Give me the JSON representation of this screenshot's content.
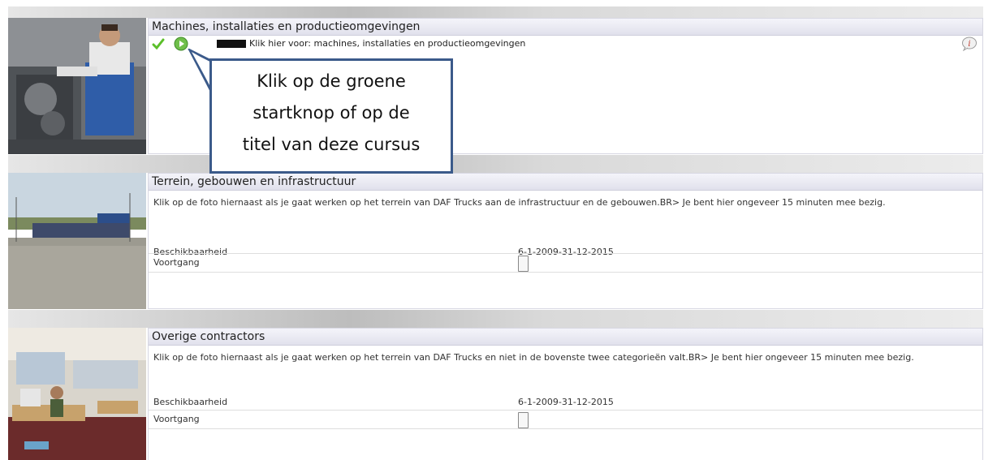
{
  "courses": [
    {
      "title": "Machines, installaties en productieomgevingen",
      "link_text": "Klik hier voor: machines, installaties en productieomgevingen",
      "icons": [
        "check-icon",
        "play-icon",
        "info-icon"
      ]
    },
    {
      "title": "Terrein, gebouwen en infrastructuur",
      "description": "Klik op de foto hiernaast als je gaat werken op het terrein van DAF Trucks aan de infrastructuur en de gebouwen.BR> Je bent hier ongeveer 15 minuten mee bezig.",
      "availability_label": "Beschikbaarheid",
      "availability_value": "6-1-2009-31-12-2015",
      "progress_label": "Voortgang"
    },
    {
      "title": "Overige contractors",
      "description": "Klik op de foto hiernaast als je gaat werken op het terrein van DAF Trucks en niet in de bovenste twee categorieën valt.BR> Je bent hier ongeveer 15 minuten mee bezig.",
      "availability_label": "Beschikbaarheid",
      "availability_value": "6-1-2009-31-12-2015",
      "progress_label": "Voortgang"
    }
  ],
  "callout": {
    "line1": "Klik op de groene",
    "line2": "startknop of op de",
    "line3": "titel van deze cursus"
  },
  "colors": {
    "header_bg": "#e6e6f0",
    "callout_border": "#3b5a8a",
    "check_green": "#5bbf2a",
    "play_green": "#6fbf4a"
  }
}
